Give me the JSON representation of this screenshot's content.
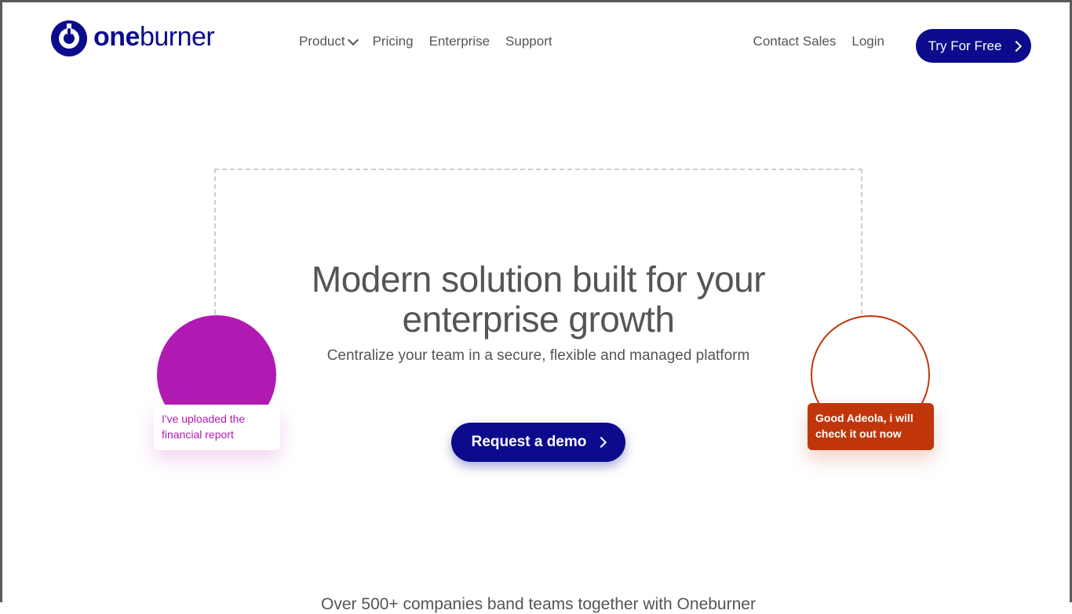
{
  "brand": {
    "name_bold": "one",
    "name_regular": "burner",
    "color": "#0b0b8c"
  },
  "nav": {
    "product": "Product",
    "pricing": "Pricing",
    "enterprise": "Enterprise",
    "support": "Support",
    "contact_sales": "Contact Sales",
    "login": "Login",
    "try_free": "Try For Free"
  },
  "hero": {
    "title": "Modern solution built for your enterprise growth",
    "subtitle": "Centralize your team in a secure, flexible and managed platform",
    "cta": "Request a demo"
  },
  "bubbles": {
    "left_message": "I've uploaded the financial report",
    "left_color": "#b01ab3",
    "right_message": "Good Adeola, i will check it out now",
    "right_color": "#c0360a"
  },
  "bottom": {
    "text": "Over 500+ companies band teams together with Oneburner"
  },
  "icons": {
    "logo": "oneburner-logo-icon",
    "product_dropdown": "chevron-down-icon",
    "try_arrow": "chevron-right-icon",
    "demo_arrow": "chevron-right-icon"
  }
}
